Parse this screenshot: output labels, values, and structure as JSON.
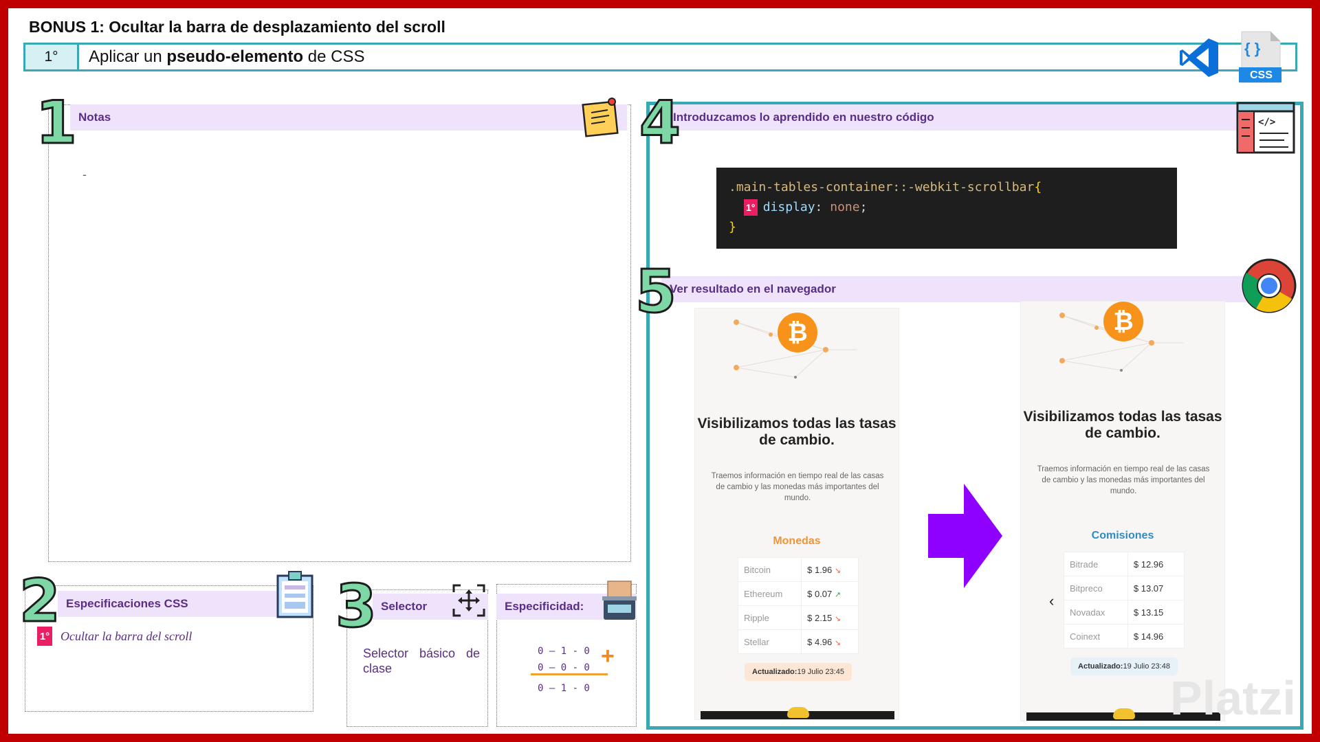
{
  "title": "BONUS 1: Ocultar la barra de desplazamiento del scroll",
  "step": {
    "number": "1°",
    "text_prefix": "Aplicar un ",
    "text_bold": "pseudo-elemento",
    "text_suffix": " de CSS"
  },
  "sections": {
    "notes": {
      "number": "1",
      "label": "Notas",
      "content": "-"
    },
    "specs": {
      "number": "2",
      "label": "Especificaciones CSS",
      "items": [
        {
          "badge": "1°",
          "text": "Ocultar la barra del scroll"
        }
      ]
    },
    "selector": {
      "number": "3",
      "label": "Selector",
      "text": "Selector básico de clase"
    },
    "specificity": {
      "label": "Especificidad:",
      "lines": [
        "0 – 1 - 0",
        "0 – 0 - 0",
        "0 – 1 - 0"
      ]
    },
    "code": {
      "number": "4",
      "label": "Introduzcamos lo aprendido en nuestro código",
      "selector": ".main-tables-container::-webkit-scrollbar",
      "open_brace": "{",
      "badge": "1°",
      "property": "display",
      "colon": ":",
      "value": "none",
      "semicolon": ";",
      "close_brace": "}"
    },
    "result": {
      "number": "5",
      "label": "Ver resultado en el navegador"
    }
  },
  "phones": [
    {
      "title": "Visibilizamos todas las tasas de cambio.",
      "description": "Traemos información en tiempo real de las casas de cambio y las monedas más importantes del mundo.",
      "section": "Monedas",
      "section_color": "#f0943a",
      "rows": [
        {
          "name": "Bitcoin",
          "value": "$ 1.96",
          "trend": "down"
        },
        {
          "name": "Ethereum",
          "value": "$ 0.07",
          "trend": "up"
        },
        {
          "name": "Ripple",
          "value": "$ 2.15",
          "trend": "down"
        },
        {
          "name": "Stellar",
          "value": "$ 4.96",
          "trend": "down"
        }
      ],
      "updated_label": "Actualizado:",
      "updated_value": " 19 Julio 23:45",
      "updated_bg": "#fde6d3"
    },
    {
      "title": "Visibilizamos todas las tasas de cambio.",
      "description": "Traemos información en tiempo real de las casas de cambio y las monedas más importantes del mundo.",
      "section": "Comisiones",
      "section_color": "#2f8bc2",
      "rows": [
        {
          "name": "Bitrade",
          "value": "$ 12.96"
        },
        {
          "name": "Bitpreco",
          "value": "$ 13.07"
        },
        {
          "name": "Novadax",
          "value": "$ 13.15"
        },
        {
          "name": "Coinext",
          "value": "$ 14.96"
        }
      ],
      "updated_label": "Actualizado:",
      "updated_value": " 19 Julio 23:48",
      "updated_bg": "#e7f1f8",
      "nav_left": "‹"
    }
  ],
  "icons": {
    "vscode": "vscode-icon",
    "css_file": "css-file-icon",
    "css_label": "CSS",
    "css_braces": "{ }",
    "notes": "sticky-note-icon",
    "code": "code-window-icon",
    "chrome": "chrome-icon",
    "clipboard": "clipboard-icon",
    "selector": "move-arrows-icon",
    "specificity": "scale-icon",
    "bitcoin_symbol": "₿"
  },
  "colors": {
    "frame": "#c00000",
    "teal": "#37a8b4",
    "lavender": "#efe3fb",
    "purple_text": "#5a2d86",
    "mint_number": "#7ed8a6",
    "badge_pink": "#e91e63",
    "arrow_purple": "#8e00ff"
  },
  "watermark": "Platzi"
}
